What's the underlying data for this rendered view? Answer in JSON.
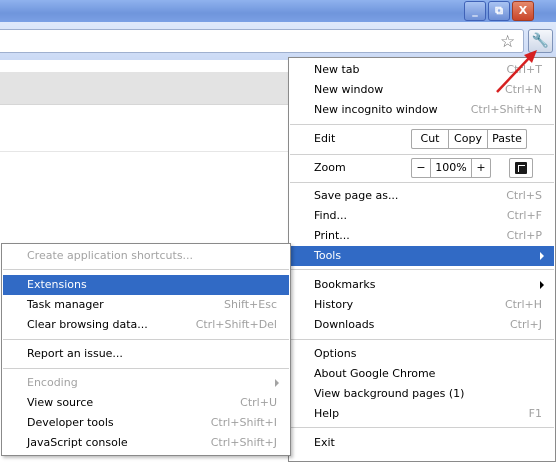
{
  "window": {
    "min_label": "_",
    "restore_label": "⧉",
    "close_label": "X"
  },
  "toolbar": {
    "star_icon": "☆",
    "wrench_icon": "🔧"
  },
  "main_menu": {
    "new_tab": {
      "label": "New tab",
      "shortcut": "Ctrl+T"
    },
    "new_window": {
      "label": "New window",
      "shortcut": "Ctrl+N"
    },
    "new_incognito": {
      "label": "New incognito window",
      "shortcut": "Ctrl+Shift+N"
    },
    "edit": {
      "label": "Edit",
      "cut": "Cut",
      "copy": "Copy",
      "paste": "Paste"
    },
    "zoom": {
      "label": "Zoom",
      "minus": "−",
      "level": "100%",
      "plus": "+"
    },
    "save_page": {
      "label": "Save page as...",
      "shortcut": "Ctrl+S"
    },
    "find": {
      "label": "Find...",
      "shortcut": "Ctrl+F"
    },
    "print": {
      "label": "Print...",
      "shortcut": "Ctrl+P"
    },
    "tools": {
      "label": "Tools"
    },
    "bookmarks": {
      "label": "Bookmarks"
    },
    "history": {
      "label": "History",
      "shortcut": "Ctrl+H"
    },
    "downloads": {
      "label": "Downloads",
      "shortcut": "Ctrl+J"
    },
    "options": {
      "label": "Options"
    },
    "about": {
      "label": "About Google Chrome"
    },
    "background_pages": {
      "label": "View background pages (1)"
    },
    "help": {
      "label": "Help",
      "shortcut": "F1"
    },
    "exit": {
      "label": "Exit"
    }
  },
  "tools_submenu": {
    "create_shortcuts": {
      "label": "Create application shortcuts..."
    },
    "extensions": {
      "label": "Extensions"
    },
    "task_manager": {
      "label": "Task manager",
      "shortcut": "Shift+Esc"
    },
    "clear_browsing": {
      "label": "Clear browsing data...",
      "shortcut": "Ctrl+Shift+Del"
    },
    "report_issue": {
      "label": "Report an issue..."
    },
    "encoding": {
      "label": "Encoding"
    },
    "view_source": {
      "label": "View source",
      "shortcut": "Ctrl+U"
    },
    "developer_tools": {
      "label": "Developer tools",
      "shortcut": "Ctrl+Shift+I"
    },
    "javascript_console": {
      "label": "JavaScript console",
      "shortcut": "Ctrl+Shift+J"
    }
  },
  "colors": {
    "highlight": "#316ac5",
    "annotation_arrow": "#d62020"
  }
}
